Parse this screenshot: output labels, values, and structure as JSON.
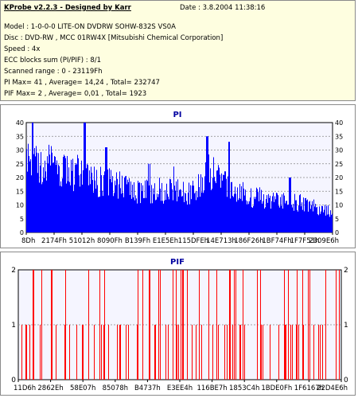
{
  "info": {
    "title": "KProbe v2.2.3 - Designed by Karr",
    "date": "Date : 3.8.2004 11:38:16",
    "model": "Model : 1-0-0-0 LITE-ON DVDRW SOHW-832S  VS0A",
    "disc": "Disc : DVD-RW , MCC 01RW4X  [Mitsubishi Chemical Corporation]",
    "speed": "Speed : 4x",
    "ecc": "ECC blocks sum (PI/PIF) : 8/1",
    "range": "Scanned range : 0 - 23119Fh",
    "pi_stats": "PI Max= 41 , Average= 14,24 , Total= 232747",
    "pif_stats": "PIF Max= 2 , Average= 0,01 , Total= 1923"
  },
  "chart_data": [
    {
      "type": "bar",
      "title": "PI",
      "ylim": [
        0,
        40
      ],
      "yticks": [
        0,
        5,
        10,
        15,
        20,
        25,
        30,
        35,
        40
      ],
      "xtick_labels": [
        "8Dh",
        "2174Fh",
        "51012h",
        "8090Fh",
        "B139Fh",
        "E1E5Eh",
        "115DFEh",
        "14E713h",
        "186F26h",
        "1BF74Fh",
        "1F7F53h",
        "2309E6h"
      ],
      "grid": true,
      "color": "#0000ff",
      "profile": [
        [
          0,
          32
        ],
        [
          2,
          34
        ],
        [
          4,
          32
        ],
        [
          6,
          31
        ],
        [
          8,
          31
        ],
        [
          10,
          29
        ],
        [
          12,
          28
        ],
        [
          14,
          26
        ],
        [
          16,
          27
        ],
        [
          18,
          27
        ],
        [
          20,
          24
        ],
        [
          22,
          24
        ],
        [
          24,
          23
        ],
        [
          26,
          24
        ],
        [
          28,
          24
        ],
        [
          30,
          22
        ],
        [
          32,
          21
        ],
        [
          34,
          20
        ],
        [
          36,
          19
        ],
        [
          38,
          19
        ],
        [
          40,
          18
        ],
        [
          42,
          19
        ],
        [
          44,
          19
        ],
        [
          46,
          19
        ],
        [
          48,
          18
        ],
        [
          50,
          19
        ],
        [
          52,
          18
        ],
        [
          54,
          18
        ],
        [
          56,
          21
        ],
        [
          58,
          22
        ],
        [
          59,
          28
        ],
        [
          62,
          27
        ],
        [
          65,
          24
        ],
        [
          67,
          20
        ],
        [
          68,
          19
        ],
        [
          70,
          18
        ],
        [
          72,
          17
        ],
        [
          74,
          16
        ],
        [
          76,
          16
        ],
        [
          78,
          15
        ],
        [
          80,
          15
        ],
        [
          82,
          15
        ],
        [
          84,
          14
        ],
        [
          86,
          14
        ],
        [
          88,
          14
        ],
        [
          90,
          13
        ],
        [
          92,
          12
        ],
        [
          94,
          12
        ],
        [
          96,
          11
        ],
        [
          98,
          10
        ],
        [
          100,
          9
        ]
      ],
      "spikes": [
        [
          2,
          41
        ],
        [
          19,
          40
        ],
        [
          26,
          31
        ],
        [
          40,
          25
        ],
        [
          48,
          24
        ],
        [
          59,
          35
        ],
        [
          66,
          33
        ],
        [
          83,
          24
        ],
        [
          86,
          20
        ]
      ]
    },
    {
      "type": "bar",
      "title": "PIF",
      "ylim": [
        0,
        2
      ],
      "yticks": [
        0,
        1,
        2
      ],
      "xtick_labels": [
        "11D6h",
        "2862Eh",
        "58E07h",
        "85078h",
        "B4737h",
        "E3EE4h",
        "116BE7h",
        "1853C4h",
        "1BDE0Fh",
        "1F6167h",
        "22D4E6h"
      ],
      "grid": true,
      "color": "#ff0000",
      "max": 2,
      "average": 0.01,
      "total": 1923
    }
  ]
}
